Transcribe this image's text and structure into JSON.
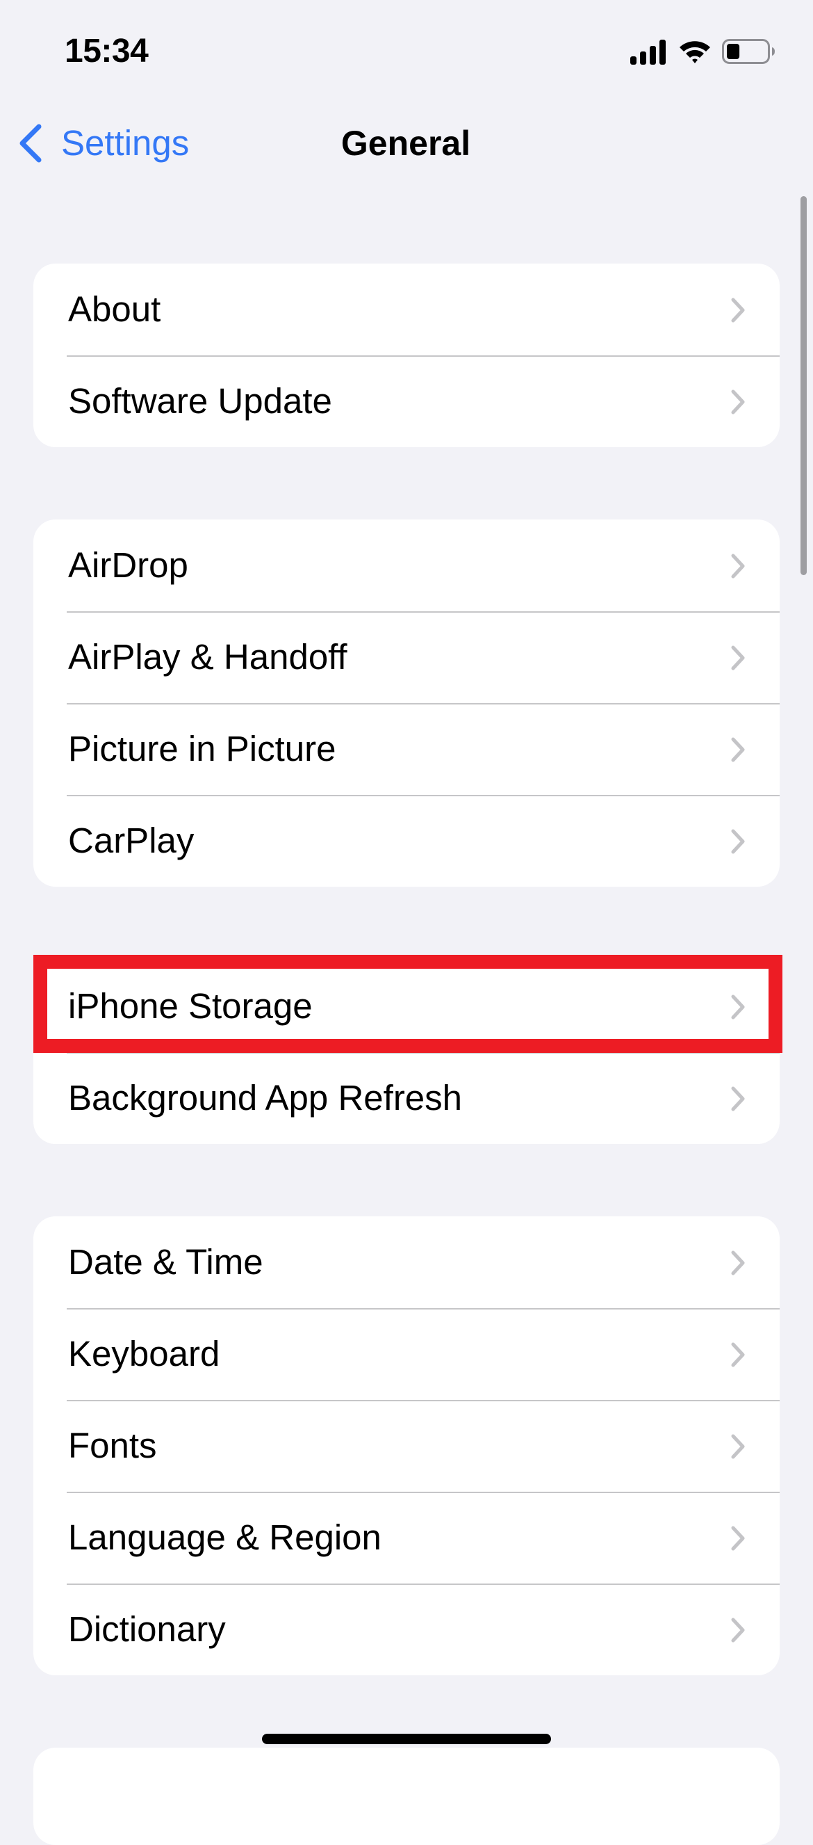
{
  "status_bar": {
    "time": "15:34",
    "icons": [
      "cellular-signal-icon",
      "wifi-icon",
      "battery-icon"
    ],
    "battery_level_percent": 33
  },
  "nav": {
    "back_label": "Settings",
    "back_icon": "chevron-left-icon",
    "title": "General"
  },
  "colors": {
    "accent": "#3478F6",
    "background": "#F2F2F7",
    "highlight": "#ED1C24",
    "chevron": "#C4C4C7"
  },
  "groups": [
    {
      "items": [
        {
          "label": "About"
        },
        {
          "label": "Software Update"
        }
      ]
    },
    {
      "items": [
        {
          "label": "AirDrop"
        },
        {
          "label": "AirPlay & Handoff"
        },
        {
          "label": "Picture in Picture"
        },
        {
          "label": "CarPlay"
        }
      ]
    },
    {
      "items": [
        {
          "label": "iPhone Storage",
          "highlighted": true
        },
        {
          "label": "Background App Refresh"
        }
      ]
    },
    {
      "items": [
        {
          "label": "Date & Time"
        },
        {
          "label": "Keyboard"
        },
        {
          "label": "Fonts"
        },
        {
          "label": "Language & Region"
        },
        {
          "label": "Dictionary"
        }
      ]
    },
    {
      "items": []
    }
  ]
}
